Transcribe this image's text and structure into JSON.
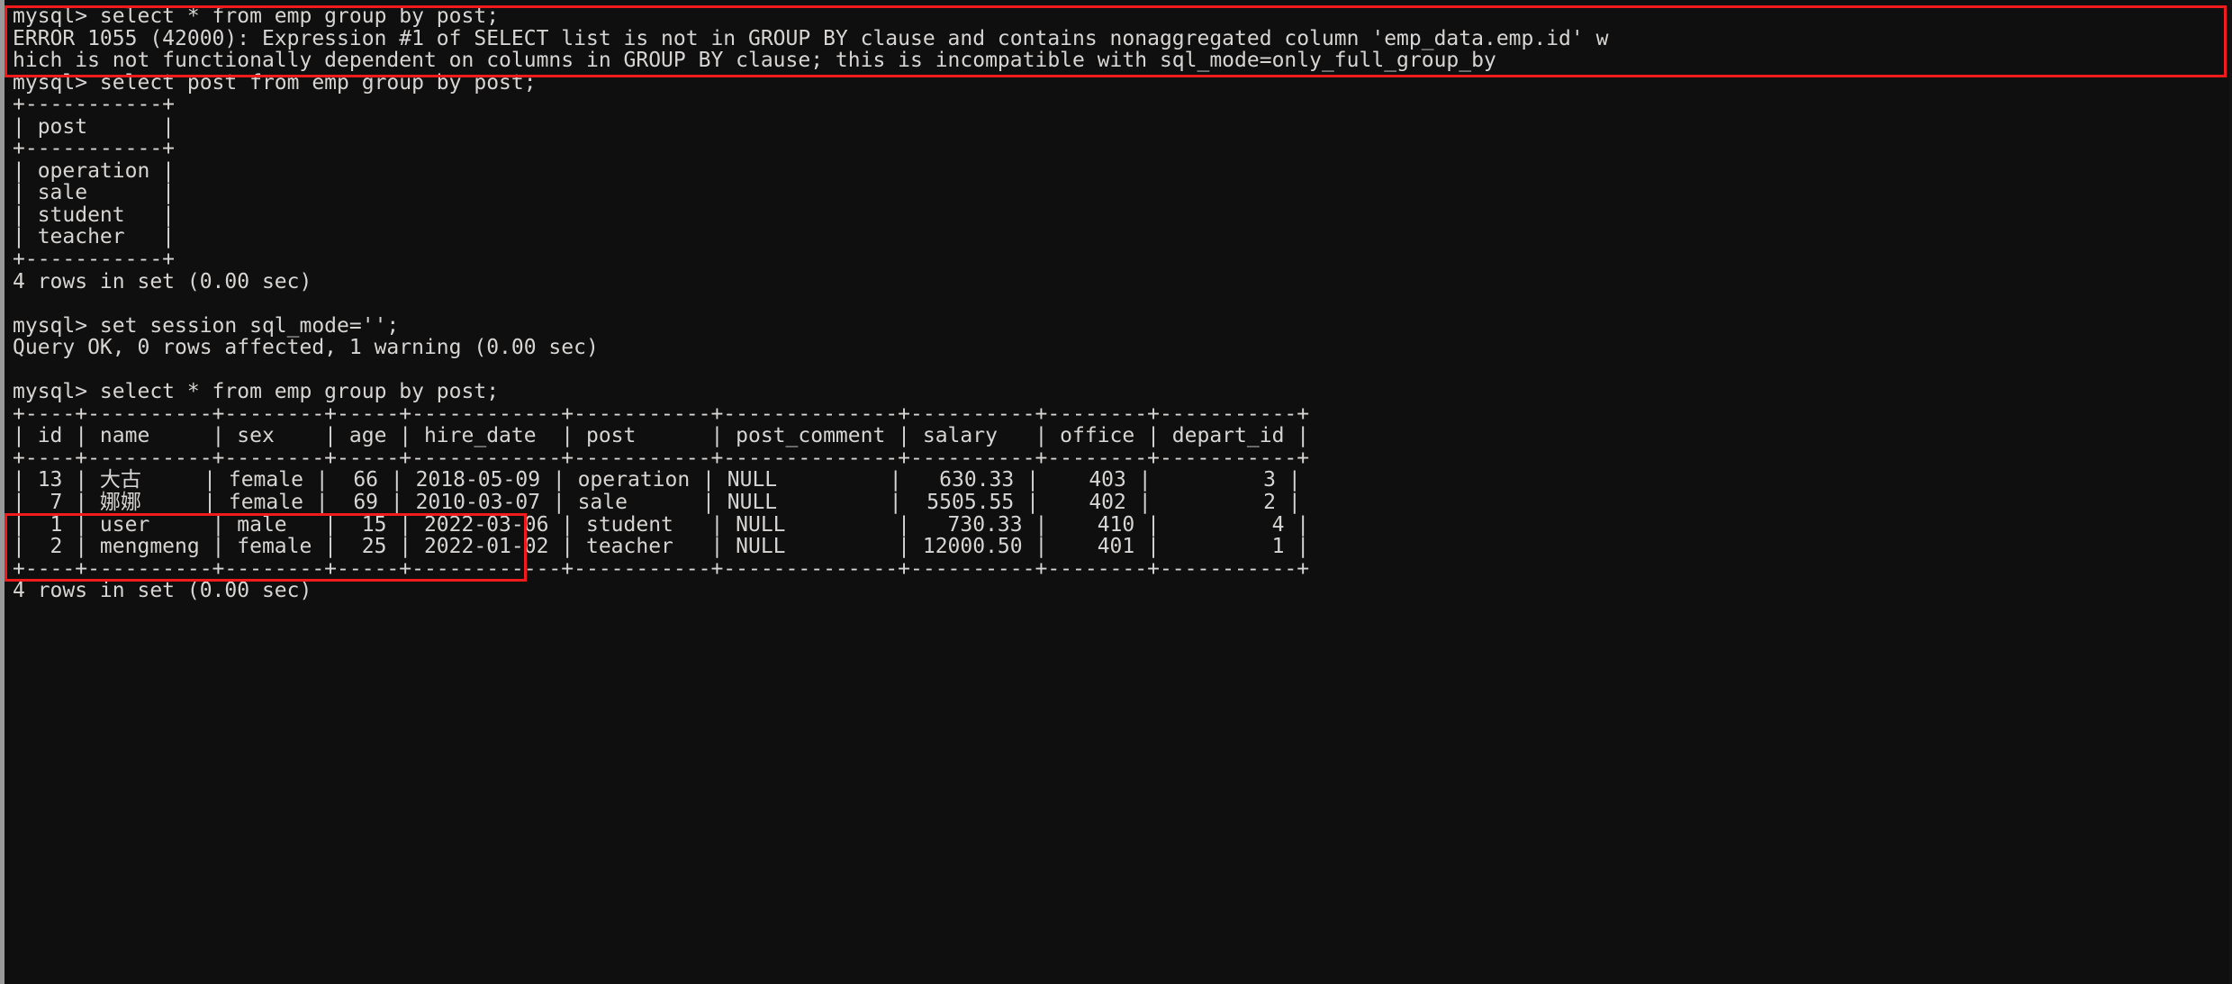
{
  "terminal": {
    "prompt": "mysql>",
    "background_color": "#100f0f",
    "text_color": "#d6d5d3",
    "highlight_color": "#f21b1b",
    "lines": [
      "mysql> select * from emp group by post;",
      "ERROR 1055 (42000): Expression #1 of SELECT list is not in GROUP BY clause and contains nonaggregated column 'emp_data.emp.id' w",
      "hich is not functionally dependent on columns in GROUP BY clause; this is incompatible with sql_mode=only_full_group_by",
      "mysql> select post from emp group by post;",
      "+-----------+",
      "| post      |",
      "+-----------+",
      "| operation |",
      "| sale      |",
      "| student   |",
      "| teacher   |",
      "+-----------+",
      "4 rows in set (0.00 sec)",
      "",
      "mysql> set session sql_mode='';",
      "Query OK, 0 rows affected, 1 warning (0.00 sec)",
      "",
      "mysql> select * from emp group by post;",
      "+----+----------+--------+-----+------------+-----------+--------------+----------+--------+-----------+",
      "| id | name     | sex    | age | hire_date  | post      | post_comment | salary   | office | depart_id |",
      "+----+----------+--------+-----+------------+-----------+--------------+----------+--------+-----------+",
      "| 13 | 大古     | female |  66 | 2018-05-09 | operation | NULL         |   630.33 |    403 |         3 |",
      "|  7 | 娜娜     | female |  69 | 2010-03-07 | sale      | NULL         |  5505.55 |    402 |         2 |",
      "|  1 | user     | male   |  15 | 2022-03-06 | student   | NULL         |   730.33 |    410 |         4 |",
      "|  2 | mengmeng | female |  25 | 2022-01-02 | teacher   | NULL         | 12000.50 |    401 |         1 |",
      "+----+----------+--------+-----+------------+-----------+--------------+----------+--------+-----------+",
      "4 rows in set (0.00 sec)"
    ]
  },
  "commands": {
    "first_query": "select * from emp group by post;",
    "second_query": "select post from emp group by post;",
    "set_session": "set session sql_mode='';",
    "third_query": "select * from emp group by post;"
  },
  "error": {
    "code": "ERROR 1055 (42000)",
    "message": "Expression #1 of SELECT list is not in GROUP BY clause and contains nonaggregated column 'emp_data.emp.id' which is not functionally dependent on columns in GROUP BY clause; this is incompatible with sql_mode=only_full_group_by"
  },
  "set_session_result": "Query OK, 0 rows affected, 1 warning (0.00 sec)",
  "post_result": {
    "columns": [
      "post"
    ],
    "rows": [
      [
        "operation"
      ],
      [
        "sale"
      ],
      [
        "student"
      ],
      [
        "teacher"
      ]
    ],
    "footer": "4 rows in set (0.00 sec)"
  },
  "emp_result": {
    "columns": [
      "id",
      "name",
      "sex",
      "age",
      "hire_date",
      "post",
      "post_comment",
      "salary",
      "office",
      "depart_id"
    ],
    "rows": [
      [
        "13",
        "大古",
        "female",
        "66",
        "2018-05-09",
        "operation",
        "NULL",
        "630.33",
        "403",
        "3"
      ],
      [
        "7",
        "娜娜",
        "female",
        "69",
        "2010-03-07",
        "sale",
        "NULL",
        "5505.55",
        "402",
        "2"
      ],
      [
        "1",
        "user",
        "male",
        "15",
        "2022-03-06",
        "student",
        "NULL",
        "730.33",
        "410",
        "4"
      ],
      [
        "2",
        "mengmeng",
        "female",
        "25",
        "2022-01-02",
        "teacher",
        "NULL",
        "12000.50",
        "401",
        "1"
      ]
    ],
    "footer": "4 rows in set (0.00 sec)"
  },
  "annotations": [
    {
      "name": "error-highlight",
      "target": "ERROR 1055 block"
    },
    {
      "name": "set-session-highlight",
      "target": "set session sql_mode='' block"
    }
  ]
}
